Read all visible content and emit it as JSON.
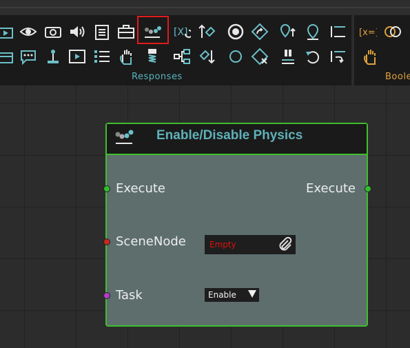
{
  "ribbon": {
    "groups": [
      {
        "label": "Responses"
      },
      {
        "label": "Boole"
      }
    ]
  },
  "node": {
    "title": "Enable/Disable Physics",
    "inputs": [
      {
        "label": "Execute",
        "pin_color": "#2fbf2c"
      },
      {
        "label": "SceneNode",
        "pin_color": "#c8281e"
      },
      {
        "label": "Task",
        "pin_color": "#b43cc8"
      }
    ],
    "outputs": [
      {
        "label": "Execute",
        "pin_color": "#2fbf2c"
      }
    ],
    "scene_node_value": "Empty",
    "task_value": "Enable"
  },
  "colors": {
    "accent": "#59b5bd",
    "node_border": "#3fbf2c",
    "selection": "#e21b1b",
    "boolean_label": "#e1a23a"
  },
  "icons": [
    "clapper-icon",
    "eye-icon",
    "camera-icon",
    "speaker-icon",
    "clipboard-icon",
    "toolbox-icon",
    "physics-icon",
    "variable-icon",
    "tag-up-icon",
    "record-circle-icon",
    "diamond-arrow-icon",
    "pin-up-icon",
    "map-pin-icon",
    "list-lines-icon",
    "clapper2-icon",
    "chat-icon",
    "joystick-icon",
    "film-icon",
    "list-icon",
    "hand-icon",
    "spring-icon",
    "hierarchy-icon",
    "tag-down-icon",
    "circle-icon",
    "diamond-x-icon",
    "stand-icon",
    "undo-icon",
    "list-arrow-icon",
    "bracket-x-icon",
    "venn-icon",
    "hand-yellow-icon"
  ]
}
